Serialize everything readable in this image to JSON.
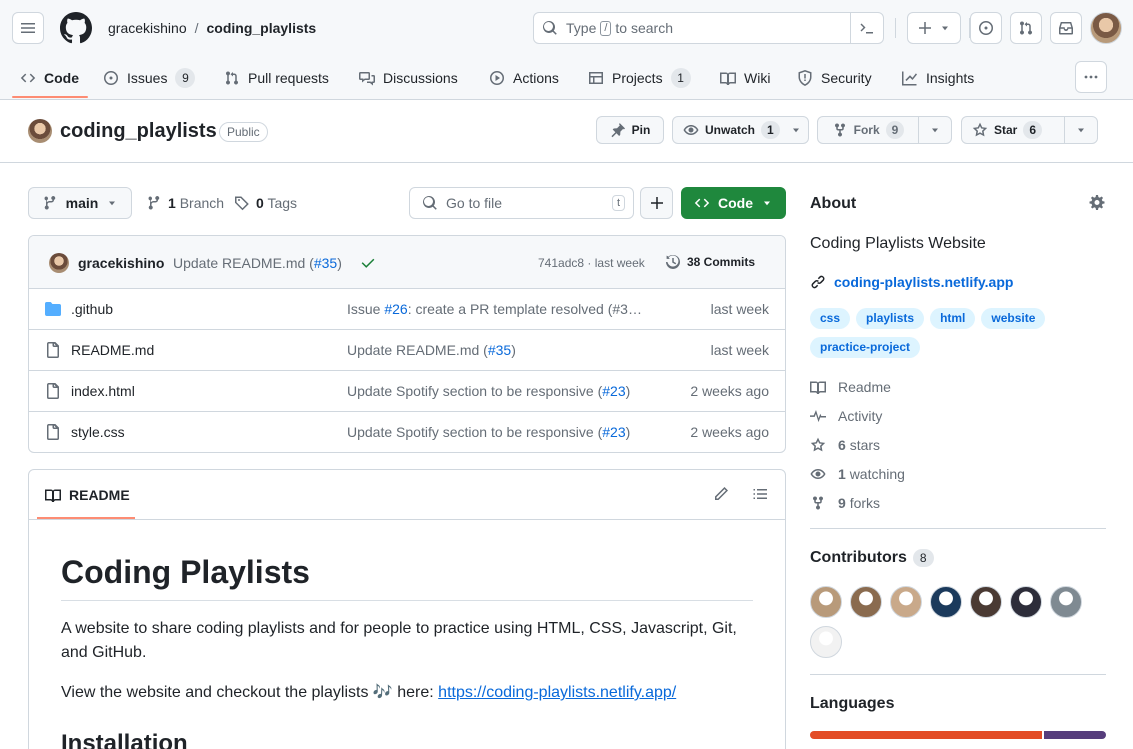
{
  "header": {
    "owner": "gracekishino",
    "separator": "/",
    "repo": "coding_playlists",
    "search_before": "Type",
    "search_key": "/",
    "search_after": "to search"
  },
  "tabs": [
    {
      "label": "Code"
    },
    {
      "label": "Issues",
      "count": "9"
    },
    {
      "label": "Pull requests"
    },
    {
      "label": "Discussions"
    },
    {
      "label": "Actions"
    },
    {
      "label": "Projects",
      "count": "1"
    },
    {
      "label": "Wiki"
    },
    {
      "label": "Security"
    },
    {
      "label": "Insights"
    }
  ],
  "repo": {
    "name": "coding_playlists",
    "visibility": "Public",
    "pin_label": "Pin",
    "unwatch_label": "Unwatch",
    "watch_count": "1",
    "fork_label": "Fork",
    "fork_count": "9",
    "star_label": "Star",
    "star_count": "6"
  },
  "filenav": {
    "branch": "main",
    "branches_count": "1",
    "branches_label": "Branch",
    "tags_count": "0",
    "tags_label": "Tags",
    "goto_placeholder": "Go to file",
    "goto_key": "t",
    "code_label": "Code"
  },
  "commit": {
    "author": "gracekishino",
    "message_text": "Update README.md (",
    "message_link": "#35",
    "message_close": ")",
    "hash": "741adc8",
    "sep": "·",
    "when": "last week",
    "commits_label": "38 Commits"
  },
  "files": [
    {
      "name": ".github",
      "type": "folder",
      "msg_pre": "Issue ",
      "msg_link": "#26",
      "msg_post": ": create a PR template resolved (#3…",
      "date": "last week"
    },
    {
      "name": "README.md",
      "type": "file",
      "msg_pre": "Update README.md (",
      "msg_link": "#35",
      "msg_post": ")",
      "date": "last week"
    },
    {
      "name": "index.html",
      "type": "file",
      "msg_pre": "Update Spotify section to be responsive (",
      "msg_link": "#23",
      "msg_post": ")",
      "date": "2 weeks ago"
    },
    {
      "name": "style.css",
      "type": "file",
      "msg_pre": "Update Spotify section to be responsive (",
      "msg_link": "#23",
      "msg_post": ")",
      "date": "2 weeks ago"
    }
  ],
  "readme": {
    "tab_label": "README",
    "h1": "Coding Playlists",
    "p1": "A website to share coding playlists and for people to practice using HTML, CSS, Javascript, Git, and GitHub.",
    "p2_text": "View the website and checkout the playlists 🎶 here: ",
    "p2_link": "https://coding-playlists.netlify.app/",
    "h2": "Installation"
  },
  "about": {
    "title": "About",
    "description": "Coding Playlists Website",
    "link": "coding-playlists.netlify.app",
    "topics": [
      "css",
      "playlists",
      "html",
      "website",
      "practice-project"
    ],
    "readme_label": "Readme",
    "activity_label": "Activity",
    "stars_count": "6",
    "stars_label": "stars",
    "watching_count": "1",
    "watching_label": "watching",
    "forks_count": "9",
    "forks_label": "forks"
  },
  "contributors": {
    "title": "Contributors",
    "count": "8",
    "avatar_colors": [
      "#b89a7a",
      "#8a6b4f",
      "#c9a98a",
      "#1b3a5c",
      "#4a3a33",
      "#2d2d3a",
      "#7f8a92",
      "#f2f2f2"
    ]
  },
  "languages": {
    "title": "Languages",
    "colors": [
      "#e34c26",
      "#563d7c"
    ],
    "shares": [
      0.79,
      0.21
    ]
  }
}
